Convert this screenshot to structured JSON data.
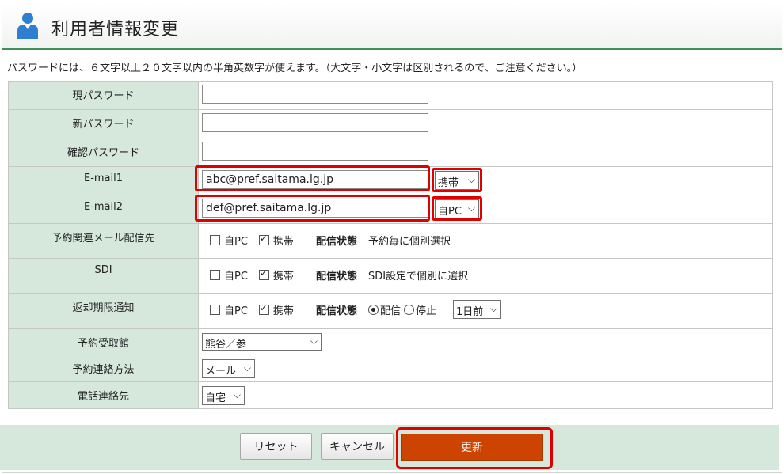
{
  "header": {
    "title": "利用者情報変更"
  },
  "note": "パスワードには、６文字以上２０文字以内の半角英数字が使えます。（大文字・小文字は区別されるので、ご注意ください。）",
  "rows": {
    "current_password": {
      "label": "現パスワード",
      "value": ""
    },
    "new_password": {
      "label": "新パスワード",
      "value": ""
    },
    "confirm_password": {
      "label": "確認パスワード",
      "value": ""
    },
    "email1": {
      "label": "E-mail1",
      "value": "abc@pref.saitama.lg.jp",
      "type_selected": "携帯"
    },
    "email2": {
      "label": "E-mail2",
      "value": "def@pref.saitama.lg.jp",
      "type_selected": "自PC"
    },
    "reservation_mail": {
      "label": "予約関連メール配信先",
      "opt_pc": "自PC",
      "opt_mobile": "携帯",
      "pc_checked": false,
      "mobile_checked": true,
      "status_label": "配信状態",
      "status_text": "予約毎に個別選択"
    },
    "sdi": {
      "label": "SDI",
      "opt_pc": "自PC",
      "opt_mobile": "携帯",
      "pc_checked": false,
      "mobile_checked": true,
      "status_label": "配信状態",
      "status_text": "SDI設定で個別に選択"
    },
    "return_notice": {
      "label": "返却期限通知",
      "opt_pc": "自PC",
      "opt_mobile": "携帯",
      "pc_checked": false,
      "mobile_checked": true,
      "status_label": "配信状態",
      "radio_on": "配信",
      "radio_off": "停止",
      "radio_selected": "配信",
      "days_selected": "1日前"
    },
    "pickup_library": {
      "label": "予約受取館",
      "selected": "熊谷／参"
    },
    "contact_method": {
      "label": "予約連絡方法",
      "selected": "メール"
    },
    "phone_contact": {
      "label": "電話連絡先",
      "selected": "自宅"
    }
  },
  "buttons": {
    "reset": "リセット",
    "cancel": "キャンセル",
    "update": "更新"
  },
  "colors": {
    "label_bg": "#d6e7dc",
    "accent_green": "#3f8f5a",
    "highlight_red": "#e00000",
    "primary_button": "#cc4400",
    "icon_blue": "#2f7fd1"
  }
}
